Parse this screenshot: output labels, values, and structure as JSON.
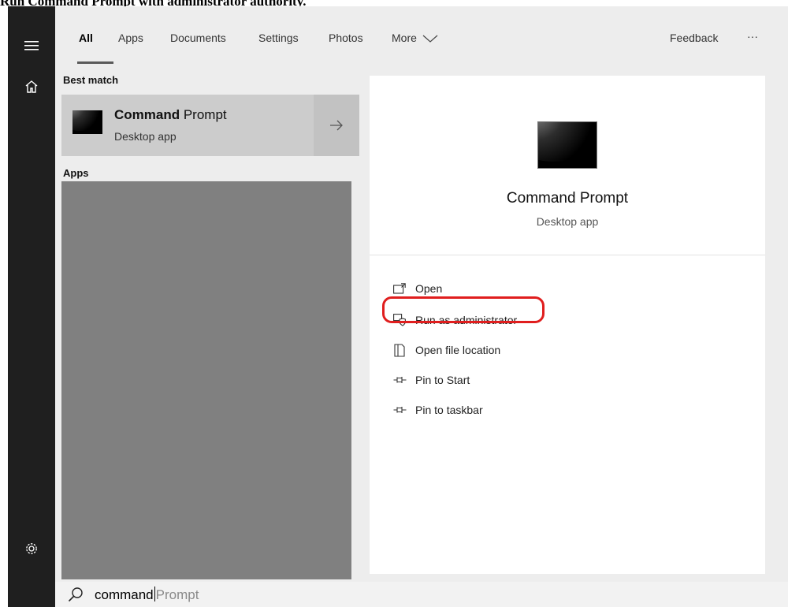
{
  "caption": "Run Command Prompt with administrator authority.",
  "rail": {
    "menu_icon": "hamburger-menu-icon",
    "home_icon": "home-icon",
    "settings_icon": "gear-icon"
  },
  "tabs": [
    {
      "label": "All",
      "active": true
    },
    {
      "label": "Apps",
      "active": false
    },
    {
      "label": "Documents",
      "active": false
    },
    {
      "label": "Settings",
      "active": false
    },
    {
      "label": "Photos",
      "active": false
    },
    {
      "label": "More",
      "active": false
    }
  ],
  "header": {
    "feedback_label": "Feedback",
    "more_options_label": "···"
  },
  "best_match": {
    "section_label": "Best match",
    "title_bold": "Command",
    "title_rest": " Prompt",
    "subtitle": "Desktop app"
  },
  "apps": {
    "section_label": "Apps"
  },
  "detail": {
    "title": "Command Prompt",
    "subtitle": "Desktop app",
    "actions": [
      {
        "label": "Open",
        "icon": "open-window-icon"
      },
      {
        "label": "Run as administrator",
        "icon": "shield-admin-icon",
        "highlighted": true
      },
      {
        "label": "Open file location",
        "icon": "file-location-icon"
      },
      {
        "label": "Pin to Start",
        "icon": "pin-icon"
      },
      {
        "label": "Pin to taskbar",
        "icon": "pin-icon"
      }
    ]
  },
  "search": {
    "typed": "command",
    "suggestion": "Prompt"
  },
  "colors": {
    "rail": "#1f1f1f",
    "selected_item": "#cccccc",
    "highlight_ring": "#e01e1e"
  }
}
